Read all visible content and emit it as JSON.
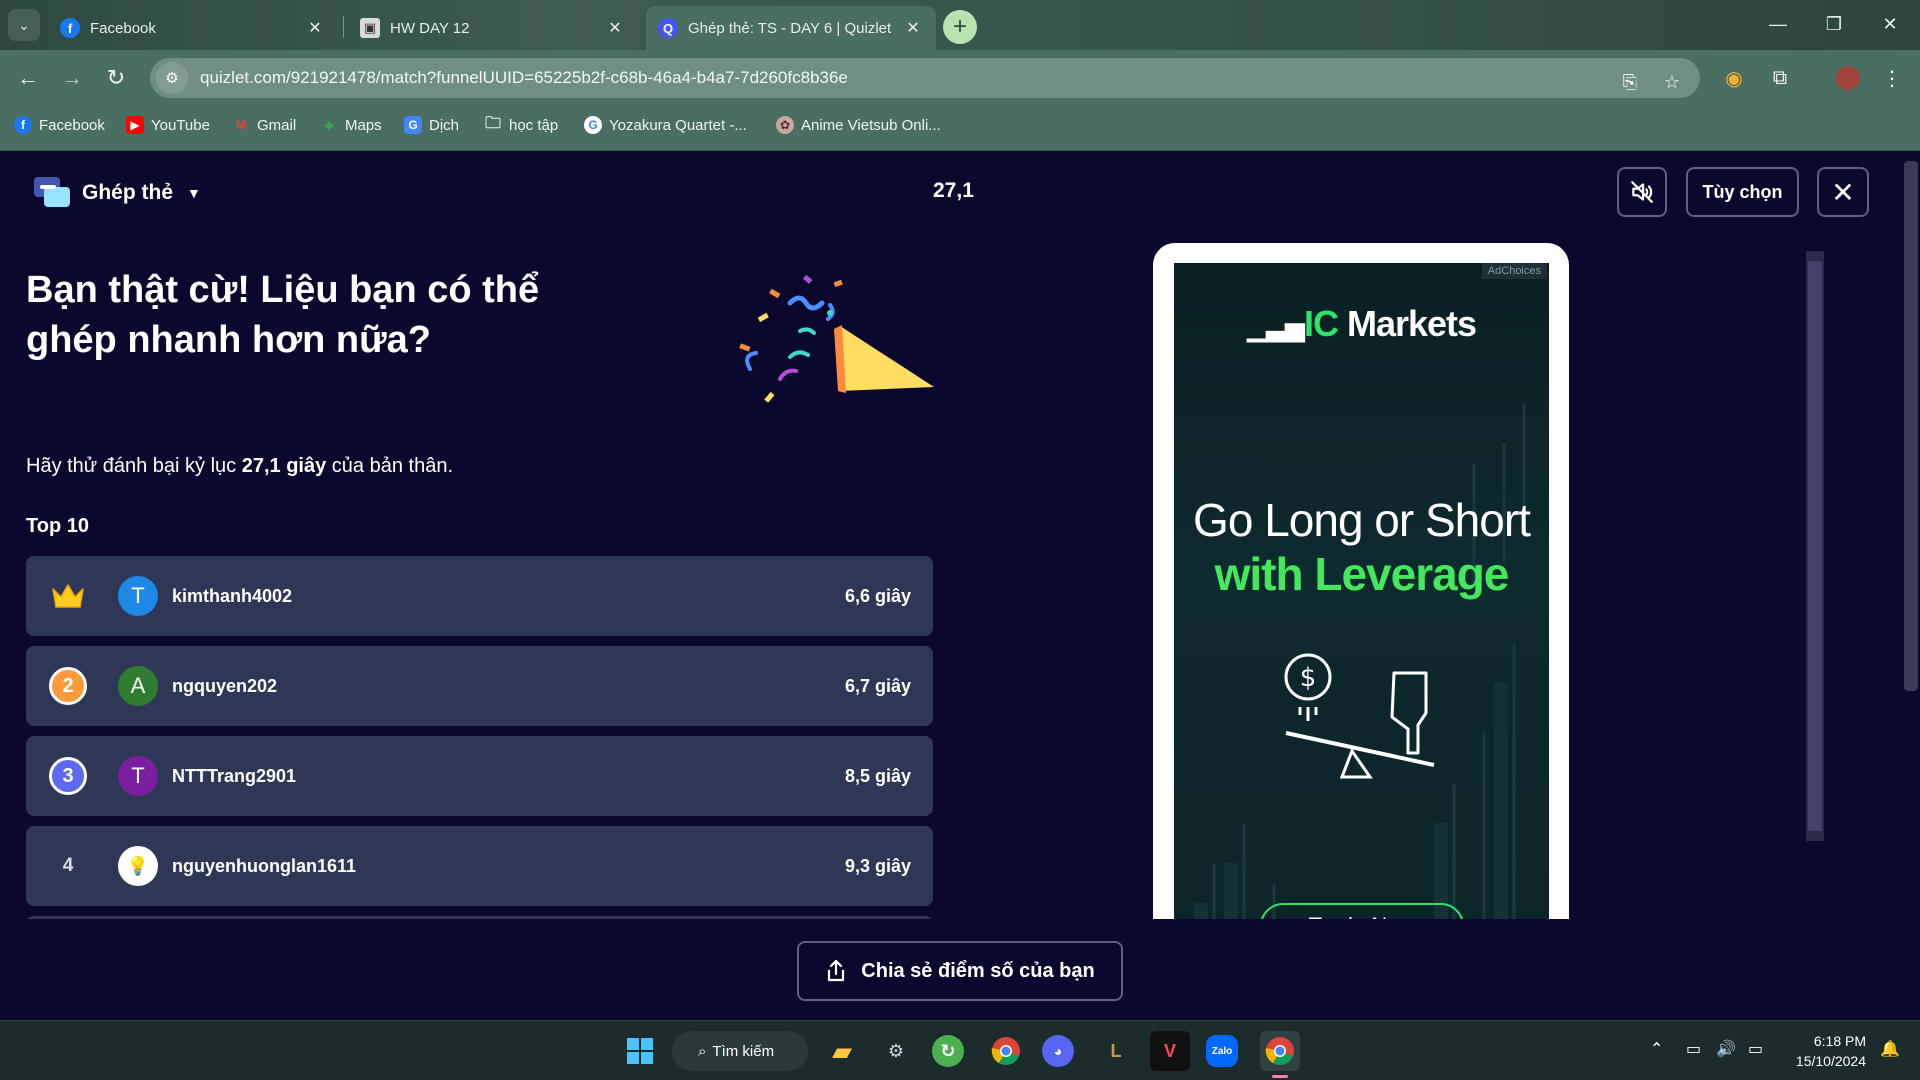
{
  "browser": {
    "tabs": [
      {
        "title": "Facebook",
        "icon": "facebook-icon"
      },
      {
        "title": "HW DAY 12",
        "icon": "page-icon"
      },
      {
        "title": "Ghép thẻ: TS - DAY 6 | Quizlet",
        "icon": "quizlet-icon"
      }
    ],
    "url": "quizlet.com/921921478/match?funnelUUID=65225b2f-c68b-46a4-b4a7-7d260fc8b36e",
    "bookmarks": [
      "Facebook",
      "YouTube",
      "Gmail",
      "Maps",
      "Dịch",
      "học tập",
      "Yozakura Quartet -...",
      "Anime Vietsub Onli..."
    ]
  },
  "header": {
    "mode_label": "Ghép thẻ",
    "timer": "27,1",
    "options_label": "Tùy chọn"
  },
  "main": {
    "headline": "Bạn thật cừ! Liệu bạn có thể ghép nhanh hơn nữa?",
    "subtitle_prefix": "Hãy thử đánh bại kỷ lục ",
    "subtitle_record": "27,1 giây",
    "subtitle_suffix": " của bản thân.",
    "top_label": "Top 10",
    "leaderboard": [
      {
        "rank": "1",
        "avatar": "T",
        "avatar_color": "#1e88e5",
        "name": "kimthanh4002",
        "score": "6,6 giây"
      },
      {
        "rank": "2",
        "avatar": "A",
        "avatar_color": "#2e7d32",
        "name": "ngquyen202",
        "score": "6,7 giây"
      },
      {
        "rank": "3",
        "avatar": "T",
        "avatar_color": "#7b1fa2",
        "name": "NTTTrang2901",
        "score": "8,5 giây"
      },
      {
        "rank": "4",
        "avatar": "💡",
        "avatar_color": "#ffffff",
        "name": "nguyenhuonglan1611",
        "score": "9,3 giây"
      }
    ],
    "share_label": "Chia sẻ điểm số của bạn"
  },
  "ad": {
    "adchoices": "AdChoices",
    "brand_prefix": "IC",
    "brand_suffix": " Markets",
    "line1": "Go Long or Short",
    "line2": "with Leverage",
    "cta": "Trade Now"
  },
  "taskbar": {
    "search_label": "Tìm kiếm",
    "time": "6:18 PM",
    "date": "15/10/2024"
  },
  "colors": {
    "background": "#0a092d",
    "card": "#2e3856",
    "medal_gold": "#f7c300",
    "medal_silver": "#ff9a3c",
    "medal_bronze": "#5b6af0",
    "ad_accent": "#2ee36b"
  }
}
